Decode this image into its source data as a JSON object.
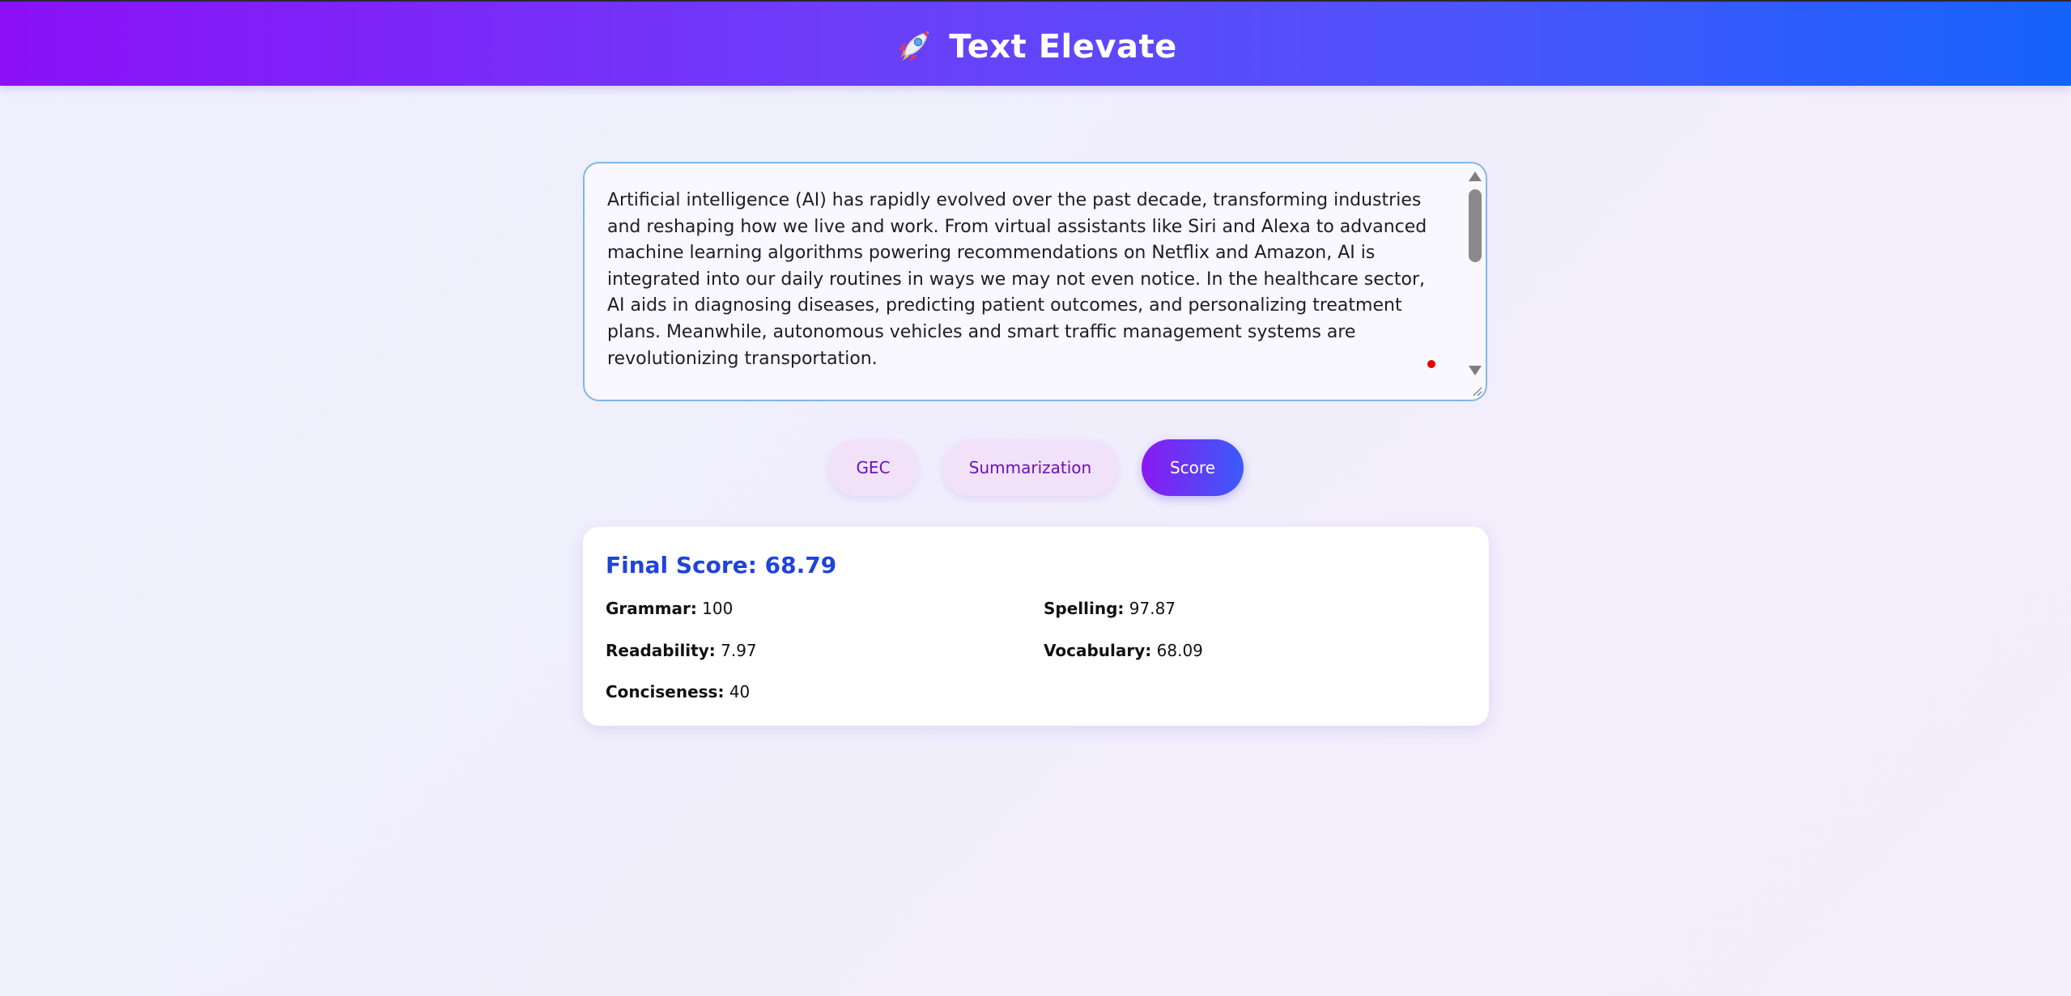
{
  "header": {
    "title": "Text Elevate",
    "icon": "rocket-icon"
  },
  "editor": {
    "value": "Artificial intelligence (AI) has rapidly evolved over the past decade, transforming industries and reshaping how we live and work. From virtual assistants like Siri and Alexa to advanced machine learning algorithms powering recommendations on Netflix and Amazon, AI is integrated into our daily routines in ways we may not even notice. In the healthcare sector, AI aids in diagnosing diseases, predicting patient outcomes, and personalizing treatment plans. Meanwhile, autonomous vehicles and smart traffic management systems are revolutionizing transportation.\n\nHowever, this rapid adoption of AI also raises important ethical and societal questions. Concerns"
  },
  "actions": {
    "gec_label": "GEC",
    "summarization_label": "Summarization",
    "score_label": "Score"
  },
  "results": {
    "final_score_label": "Final Score:",
    "final_score_value": "68.79",
    "metrics": {
      "grammar": {
        "label": "Grammar:",
        "value": "100"
      },
      "spelling": {
        "label": "Spelling:",
        "value": "97.87"
      },
      "readability": {
        "label": "Readability:",
        "value": "7.97"
      },
      "vocabulary": {
        "label": "Vocabulary:",
        "value": "68.09"
      },
      "conciseness": {
        "label": "Conciseness:",
        "value": "40"
      }
    }
  },
  "colors": {
    "header_start": "#8b10f7",
    "header_end": "#1463fb",
    "score_title": "#1f44d9",
    "light_button_bg": "#f1e2fa",
    "light_button_text": "#6b11b8"
  }
}
